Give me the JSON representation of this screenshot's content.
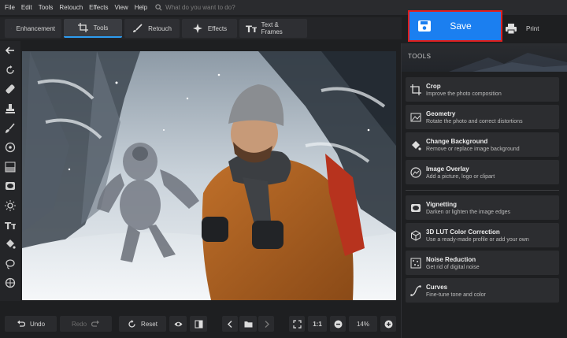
{
  "menu": [
    "File",
    "Edit",
    "Tools",
    "Retouch",
    "Effects",
    "View",
    "Help"
  ],
  "search": {
    "placeholder": "What do you want to do?"
  },
  "tabs": [
    {
      "label": "Enhancement",
      "active": false
    },
    {
      "label": "Tools",
      "active": true
    },
    {
      "label": "Retouch",
      "active": false
    },
    {
      "label": "Effects",
      "active": false
    },
    {
      "label": "Text & Frames",
      "active": false
    }
  ],
  "actions": {
    "save_label": "Save",
    "print_label": "Print"
  },
  "colors": {
    "accent": "#1b7ff0",
    "highlight": "#e02020",
    "active_tab_line": "#2d9cf0"
  },
  "left_tools": [
    "back-arrow-icon",
    "rotate-icon",
    "healing-patch-icon",
    "clone-stamp-icon",
    "brush-icon",
    "radial-filter-icon",
    "gradient-filter-icon",
    "vignette-icon",
    "light-icon",
    "text-icon",
    "fill-bucket-icon",
    "lasso-icon",
    "selection-icon"
  ],
  "bottom": {
    "undo_label": "Undo",
    "redo_label": "Redo",
    "reset_label": "Reset",
    "ratio_label": "1:1",
    "zoom_value": "14%"
  },
  "panel": {
    "title": "TOOLS",
    "cards": [
      {
        "title": "Crop",
        "subtitle": "Improve the photo composition",
        "icon": "crop-icon"
      },
      {
        "title": "Geometry",
        "subtitle": "Rotate the photo and correct distortions",
        "icon": "geometry-icon"
      },
      {
        "title": "Change Background",
        "subtitle": "Remove or replace image background",
        "icon": "paint-bucket-icon"
      },
      {
        "title": "Image Overlay",
        "subtitle": "Add a picture, logo or clipart",
        "icon": "image-overlay-icon"
      },
      {
        "title": "Vignetting",
        "subtitle": "Darken or lighten the image edges",
        "icon": "vignette-icon"
      },
      {
        "title": "3D LUT Color Correction",
        "subtitle": "Use a ready-made profile or add your own",
        "icon": "lut-cube-icon"
      },
      {
        "title": "Noise Reduction",
        "subtitle": "Get rid of digital noise",
        "icon": "noise-icon"
      },
      {
        "title": "Curves",
        "subtitle": "Fine-tune tone and color",
        "icon": "curves-icon"
      }
    ]
  }
}
